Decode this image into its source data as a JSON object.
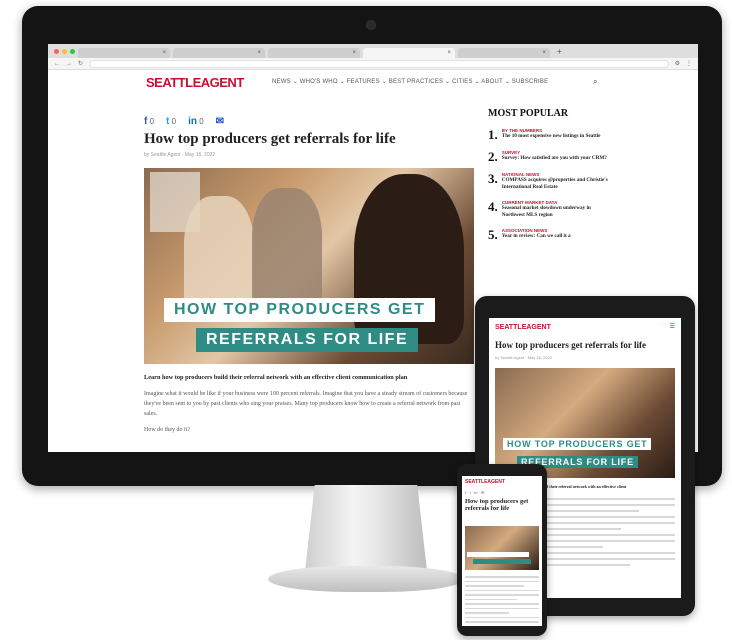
{
  "browser": {
    "tabs": [
      "×",
      "×",
      "×",
      "×",
      "×"
    ],
    "new_tab": "+"
  },
  "site": {
    "logo": "SEATTLEAGENT",
    "menu": "NEWS ⌄   WHO'S WHO ⌄   FEATURES ⌄   BEST PRACTICES ⌄   CITIES ⌄   ABOUT ⌄   SUBSCRIBE",
    "search_icon": "search-icon"
  },
  "article": {
    "share_counts": [
      "0",
      "0",
      "0"
    ],
    "headline": "How top producers get referrals for life",
    "byline": "by Seattle Agent · May 16, 2022",
    "banner_line1": "HOW TOP PRODUCERS GET",
    "banner_line2": "REFERRALS FOR LIFE",
    "lede": "Learn how top producers build their referral network with an effective client communication plan",
    "paragraph": "Imagine what it would be like if your business were 100 percent referrals. Imagine that you have a steady stream of customers because they've been sent to you by past clients who sing your praises. Many top producers know how to create a referral network from past sales.",
    "question": "How do they do it?"
  },
  "sidebar": {
    "heading": "MOST POPULAR",
    "items": [
      {
        "num": "1.",
        "cat": "BY THE NUMBERS",
        "title": "The 10 most expensive new listings in Seattle"
      },
      {
        "num": "2.",
        "cat": "SURVEY",
        "title": "Survey: How satisfied are you with your CRM?"
      },
      {
        "num": "3.",
        "cat": "NATIONAL NEWS",
        "title": "COMPASS acquires @properties and Christie's International Real Estate"
      },
      {
        "num": "4.",
        "cat": "CURRENT MARKET DATA",
        "title": "Seasonal market slowdown underway in Northwest MLS region"
      },
      {
        "num": "5.",
        "cat": "ASSOCIATION NEWS",
        "title": "Year in review: Can we call it a"
      }
    ]
  },
  "tablet": {
    "logo": "SEATTLEAGENT",
    "headline": "How top producers get referrals for life",
    "byline": "by Seattle Agent · May 16, 2022",
    "banner_line1": "HOW TOP PRODUCERS GET",
    "banner_line2": "REFERRALS FOR LIFE",
    "lede": "Learn how top producers build their referral network with an effective client"
  },
  "phone": {
    "logo": "SEATTLEAGENT",
    "headline": "How top producers get referrals for life"
  }
}
